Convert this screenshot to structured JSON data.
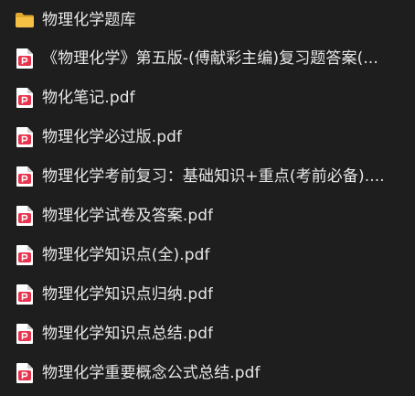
{
  "folder": {
    "name": "物理化学题库",
    "icon": "folder-icon",
    "icon_color": "#f5c043"
  },
  "files": [
    {
      "name": "《物理化学》第五版-(傅献彩主编)复习题答案(...",
      "icon": "pdf-icon"
    },
    {
      "name": "物化笔记.pdf",
      "icon": "pdf-icon"
    },
    {
      "name": "物理化学必过版.pdf",
      "icon": "pdf-icon"
    },
    {
      "name": "物理化学考前复习：基础知识+重点(考前必备)....",
      "icon": "pdf-icon"
    },
    {
      "name": "物理化学试卷及答案.pdf",
      "icon": "pdf-icon"
    },
    {
      "name": "物理化学知识点(全).pdf",
      "icon": "pdf-icon"
    },
    {
      "name": "物理化学知识点归纳.pdf",
      "icon": "pdf-icon"
    },
    {
      "name": "物理化学知识点总结.pdf",
      "icon": "pdf-icon"
    },
    {
      "name": "物理化学重要概念公式总结.pdf",
      "icon": "pdf-icon"
    }
  ],
  "colors": {
    "background": "#1e1e1e",
    "text": "#e8e8e8",
    "pdf_badge": "#e8344e",
    "pdf_page": "#ffffff"
  }
}
